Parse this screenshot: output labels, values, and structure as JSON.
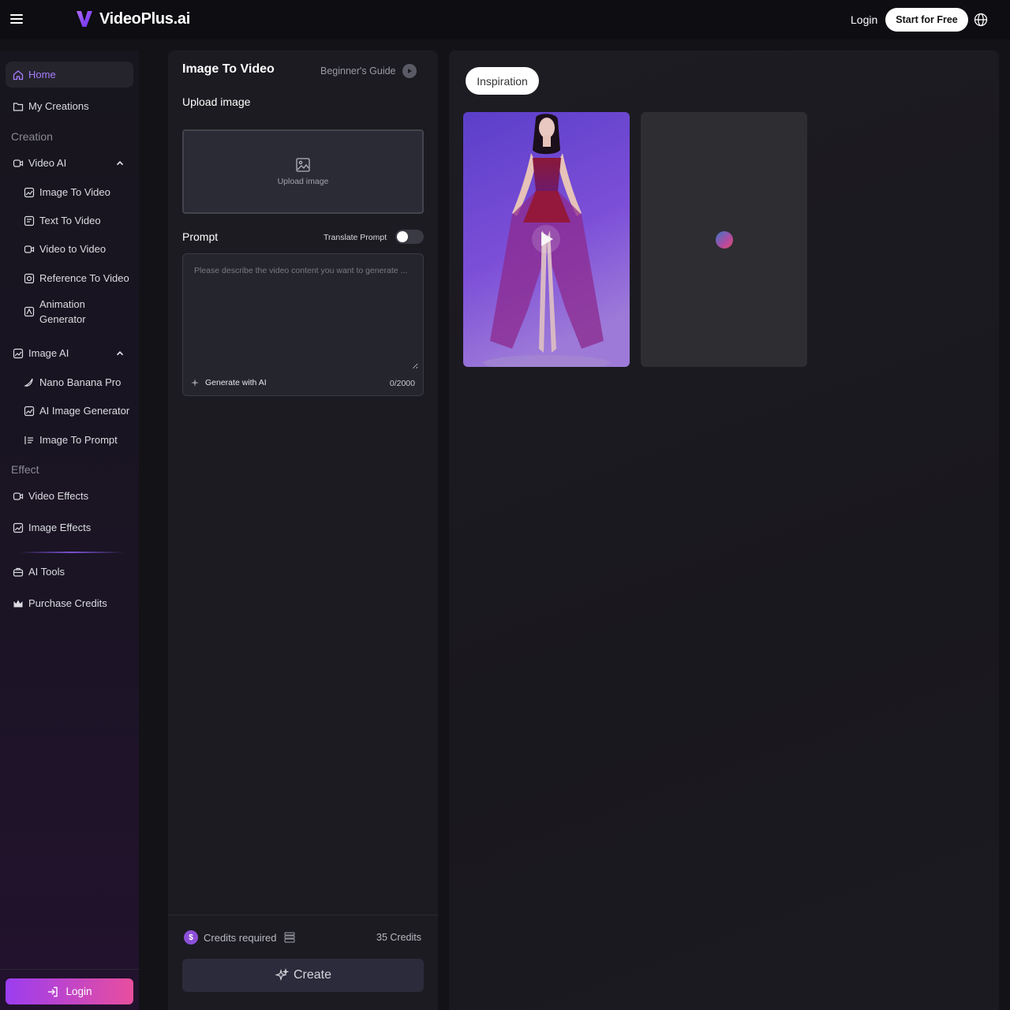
{
  "header": {
    "brand": "VideoPlus.ai",
    "login": "Login",
    "start_free": "Start for Free"
  },
  "sidebar": {
    "home": "Home",
    "my_creations": "My Creations",
    "creation_label": "Creation",
    "video_ai": "Video AI",
    "image_to_video": "Image To Video",
    "text_to_video": "Text To Video",
    "video_to_video": "Video to Video",
    "reference_to_video": "Reference To Video",
    "animation_generator_1": "Animation",
    "animation_generator_2": "Generator",
    "image_ai": "Image AI",
    "nano_banana_pro": "Nano Banana Pro",
    "ai_image_generator": "AI Image Generator",
    "image_to_prompt": "Image To Prompt",
    "effect_label": "Effect",
    "video_effects": "Video Effects",
    "image_effects": "Image Effects",
    "ai_tools": "AI Tools",
    "purchase_credits": "Purchase Credits",
    "login": "Login"
  },
  "panel": {
    "title": "Image To Video",
    "guide": "Beginner's Guide",
    "upload_label": "Upload image",
    "upload_box_text": "Upload image",
    "prompt_label": "Prompt",
    "translate_prompt": "Translate Prompt",
    "prompt_placeholder": "Please describe the video content you want to generate ...",
    "generate_with_ai": "Generate with AI",
    "counter": "0/2000",
    "credits_required": "Credits required",
    "credits_value": "35 Credits",
    "create": "Create"
  },
  "gallery": {
    "tab": "Inspiration"
  },
  "colors": {
    "accent": "#a77dff",
    "login_gradient_start": "#9b3df0",
    "login_gradient_end": "#e84e9e"
  }
}
